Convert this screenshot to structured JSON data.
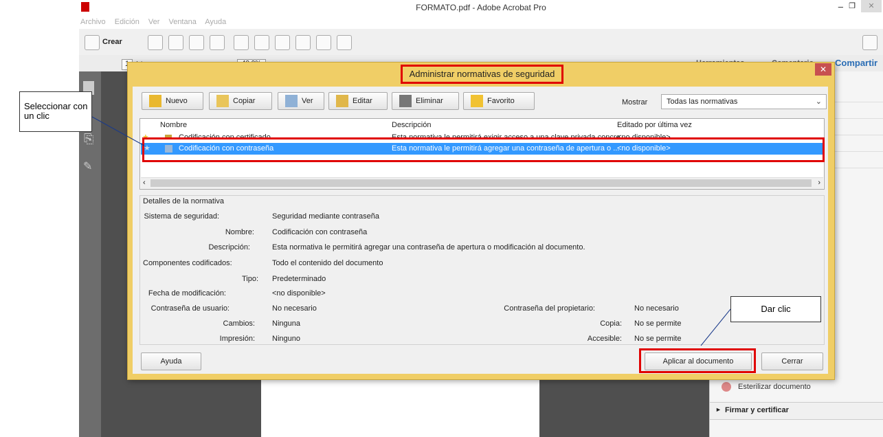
{
  "window": {
    "title": "FORMATO.pdf - Adobe Acrobat Pro",
    "menu": [
      "Archivo",
      "Edición",
      "Ver",
      "Ventana",
      "Ayuda"
    ],
    "toolbar_crear": "Crear",
    "page_num": "1",
    "page_total": "/ 1",
    "zoom": "40,9%",
    "right_tabs": [
      "Herramientas",
      "Comentario",
      "Compartir"
    ],
    "right_items": [
      "Esterilizar documento",
      "Firmar y certificar"
    ]
  },
  "dialog": {
    "title": "Administrar normativas de seguridad",
    "buttons": [
      "Nuevo",
      "Copiar",
      "Ver",
      "Editar",
      "Eliminar",
      "Favorito"
    ],
    "mostrar_label": "Mostrar",
    "mostrar_value": "Todas las normativas",
    "columns": [
      "Nombre",
      "Descripción",
      "Editado por última vez"
    ],
    "rows": [
      {
        "name": "Codificación con certificado",
        "desc": "Esta normativa le permitirá exigir acceso a una clave privada concre...",
        "edited": "<no disponible>"
      },
      {
        "name": "Codificación con contraseña",
        "desc": "Esta normativa le permitirá agregar una contraseña de apertura o ...",
        "edited": "<no disponible>"
      }
    ],
    "details_title": "Detalles de la normativa",
    "details": {
      "sistema_label": "Sistema de seguridad:",
      "sistema": "Seguridad mediante contraseña",
      "nombre_label": "Nombre:",
      "nombre": "Codificación con contraseña",
      "desc_label": "Descripción:",
      "desc": "Esta normativa le permitirá agregar una contraseña de apertura o modificación al documento.",
      "comp_label": "Componentes codificados:",
      "comp": "Todo el contenido del documento",
      "tipo_label": "Tipo:",
      "tipo": "Predeterminado",
      "fecha_label": "Fecha de modificación:",
      "fecha": "<no disponible>",
      "user_pw_label": "Contraseña de usuario:",
      "user_pw": "No necesario",
      "owner_pw_label": "Contraseña del propietario:",
      "owner_pw": "No necesario",
      "cambios_label": "Cambios:",
      "cambios": "Ninguna",
      "copia_label": "Copia:",
      "copia": "No se permite",
      "impresion_label": "Impresión:",
      "impresion": "Ninguno",
      "accesible_label": "Accesible:",
      "accesible": "No se permite"
    },
    "help": "Ayuda",
    "apply": "Aplicar al documento",
    "close": "Cerrar"
  },
  "callouts": {
    "select": "Seleccionar con un clic",
    "click": "Dar clic"
  },
  "colors": {
    "highlight": "#e00000",
    "selection": "#3399ff",
    "dialog_frame": "#f0ce66"
  }
}
